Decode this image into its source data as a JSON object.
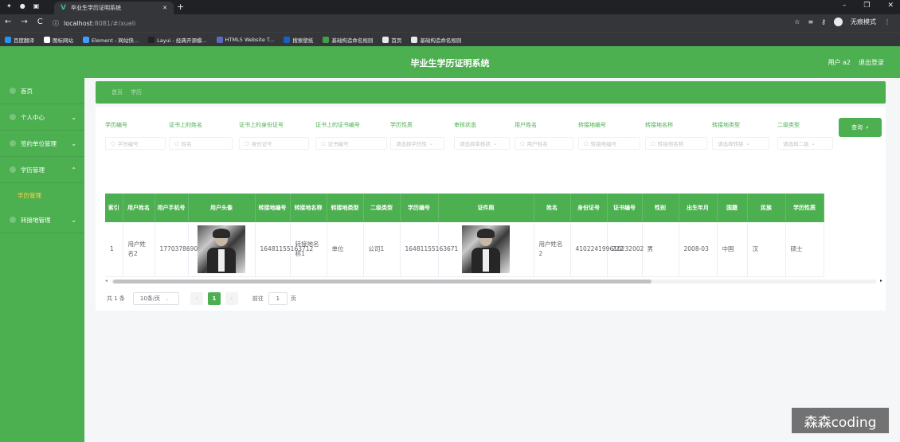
{
  "browser": {
    "tab_title": "毕业生学历证明系统",
    "tab_logo": "V",
    "url_host": "localhost",
    "url_path": ":8081/#/xueli",
    "incognito_label": "无痕模式",
    "bookmarks": [
      {
        "label": "百度翻译",
        "color": "#2196f3"
      },
      {
        "label": "图标网站",
        "color": "#ffffff"
      },
      {
        "label": "Element - 网站快...",
        "color": "#409eff"
      },
      {
        "label": "Layui - 经典开源模...",
        "color": "#222222"
      },
      {
        "label": "HTML5 Website T...",
        "color": "#5c6bc0"
      },
      {
        "label": "搜索壁纸",
        "color": "#1565c0"
      },
      {
        "label": "基础构造命名规则",
        "color": "#43a047"
      },
      {
        "label": "首页",
        "color": "#e8eaed"
      },
      {
        "label": "基础构造命名规则",
        "color": "#e8eaed"
      }
    ]
  },
  "header": {
    "title": "毕业生学历证明系统",
    "user": "用户 a2",
    "logout": "退出登录"
  },
  "sidebar": {
    "items": [
      {
        "label": "首页",
        "chev": ""
      },
      {
        "label": "个人中心",
        "chev": "⌄"
      },
      {
        "label": "签约单位管理",
        "chev": "⌄"
      },
      {
        "label": "学历管理",
        "chev": "⌃"
      },
      {
        "label": "转接地管理",
        "chev": "⌄"
      }
    ],
    "sub_item": "学历管理"
  },
  "breadcrumb": {
    "home": "首页",
    "current": "学历"
  },
  "filters": [
    {
      "label": "学历编号",
      "placeholder": "学历编号",
      "icon": "○"
    },
    {
      "label": "证书上的姓名",
      "placeholder": "姓名",
      "icon": "○"
    },
    {
      "label": "证书上的身份证号",
      "placeholder": "身份证号",
      "icon": "○"
    },
    {
      "label": "证书上的证书编号",
      "placeholder": "证书编号",
      "icon": "○"
    },
    {
      "label": "学历性质",
      "placeholder": "请选择学历性",
      "icon": "⌄"
    },
    {
      "label": "审核状态",
      "placeholder": "请选择审核状",
      "icon": "⌄"
    },
    {
      "label": "用户姓名",
      "placeholder": "用户姓名",
      "icon": "○"
    },
    {
      "label": "转接地编号",
      "placeholder": "转接地编号",
      "icon": "○"
    },
    {
      "label": "转接地名称",
      "placeholder": "转接地名称",
      "icon": "○"
    },
    {
      "label": "转接地类型",
      "placeholder": "请选择转接",
      "icon": "⌄"
    },
    {
      "label": "二级类型",
      "placeholder": "请选择二级",
      "icon": "⌄"
    }
  ],
  "search_button": "查询",
  "table": {
    "headers": [
      "索引",
      "用户姓名",
      "用户手机号",
      "用户头像",
      "转接地编号",
      "转接地名称",
      "转接地类型",
      "二级类型",
      "学历编号",
      "证件照",
      "姓名",
      "身份证号",
      "证书编号",
      "性别",
      "出生年月",
      "国籍",
      "民族",
      "学历性质"
    ],
    "rows": [
      [
        "1",
        "用户姓名2",
        "17703786902",
        "",
        "16481155163712",
        "转接地名称1",
        "单位",
        "公司1",
        "16481155163671",
        "",
        "用户姓名2",
        "410224199610232002",
        "222",
        "男",
        "2008-03",
        "中国",
        "汉",
        "硕士"
      ]
    ]
  },
  "pager": {
    "total": "共 1 条",
    "size": "10条/页",
    "prev": "‹",
    "current": "1",
    "next": "›",
    "goto_label": "前往",
    "goto_value": "1",
    "page_unit": "页"
  },
  "watermark": "森森coding"
}
